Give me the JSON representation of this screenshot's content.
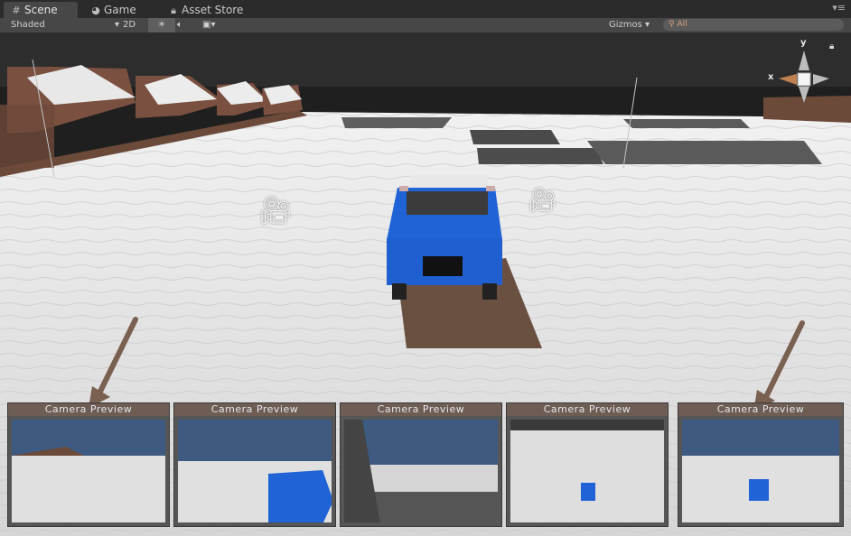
{
  "tabs": [
    {
      "label": "Scene",
      "icon": "grid-icon"
    },
    {
      "label": "Game",
      "icon": "pacman-icon"
    },
    {
      "label": "Asset Store",
      "icon": "lock-icon"
    }
  ],
  "toolbar": {
    "shading_mode": "Shaded",
    "toggle_2d": "2D",
    "gizmos": "Gizmos",
    "search_placeholder": "All"
  },
  "gizmo": {
    "y_label": "y",
    "x_label": "x"
  },
  "previews": [
    {
      "title": "Camera Preview"
    },
    {
      "title": "Camera Preview"
    },
    {
      "title": "Camera Preview"
    },
    {
      "title": "Camera Preview"
    },
    {
      "title": "Camera Preview"
    }
  ],
  "colors": {
    "car": "#1f63d6",
    "arrow": "#7a6050",
    "header": "#6e5d55"
  }
}
